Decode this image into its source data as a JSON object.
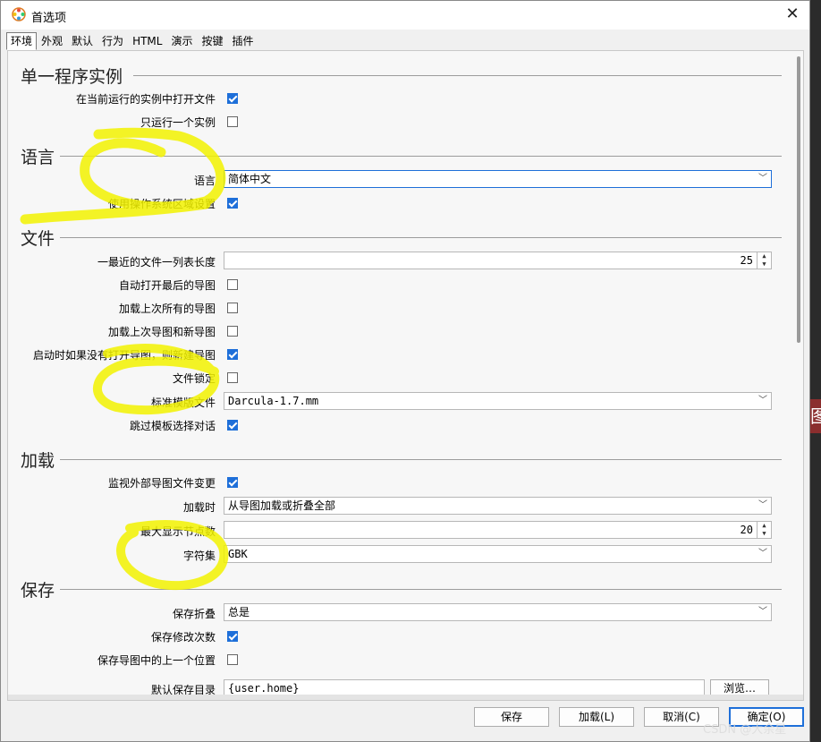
{
  "window": {
    "title": "首选项",
    "close_glyph": "✕"
  },
  "tabs": [
    "环境",
    "外观",
    "默认",
    "行为",
    "HTML",
    "演示",
    "按键",
    "插件"
  ],
  "sections": {
    "instance": "单一程序实例",
    "language": "语言",
    "files": "文件",
    "loading": "加载",
    "save": "保存"
  },
  "rows": {
    "open_in_running": {
      "label": "在当前运行的实例中打开文件",
      "checked": true
    },
    "single_instance": {
      "label": "只运行一个实例",
      "checked": false
    },
    "language": {
      "label": "语言",
      "value": "简体中文"
    },
    "use_os_locale": {
      "label": "使用操作系统区域设置",
      "checked": true
    },
    "recent_list_len": {
      "label": "一最近的文件一列表长度",
      "value": "25"
    },
    "auto_open_last": {
      "label": "自动打开最后的导图",
      "checked": false
    },
    "load_all_last": {
      "label": "加载上次所有的导图",
      "checked": false
    },
    "load_last_and_new": {
      "label": "加载上次导图和新导图",
      "checked": false
    },
    "create_new_if_none": {
      "label": "启动时如果没有打开导图，则新建导图",
      "checked": true
    },
    "file_lock": {
      "label": "文件锁定",
      "checked": false
    },
    "standard_template": {
      "label": "标准模版文件",
      "value": "Darcula-1.7.mm"
    },
    "skip_template_dialog": {
      "label": "跳过模板选择对话",
      "checked": true
    },
    "watch_external": {
      "label": "监视外部导图文件变更",
      "checked": true
    },
    "on_load": {
      "label": "加载时",
      "value": "从导图加载或折叠全部"
    },
    "max_nodes": {
      "label": "最大显示节点数",
      "value": "20"
    },
    "charset": {
      "label": "字符集",
      "value": "GBK"
    },
    "save_folding": {
      "label": "保存折叠",
      "value": "总是"
    },
    "save_mod_count": {
      "label": "保存修改次数",
      "checked": true
    },
    "save_last_position": {
      "label": "保存导图中的上一个位置",
      "checked": false
    },
    "default_save_dir": {
      "label": "默认保存目录",
      "value": "{user.home}",
      "browse": "浏览…"
    }
  },
  "buttons": {
    "save": "保存",
    "load": "加载(L)",
    "cancel": "取消(C)",
    "ok": "确定(O)"
  },
  "background_fragment": "图",
  "watermark": "CSDN @大余星",
  "colors": {
    "accent": "#1e6fd9",
    "highlighter": "#f2f200"
  }
}
